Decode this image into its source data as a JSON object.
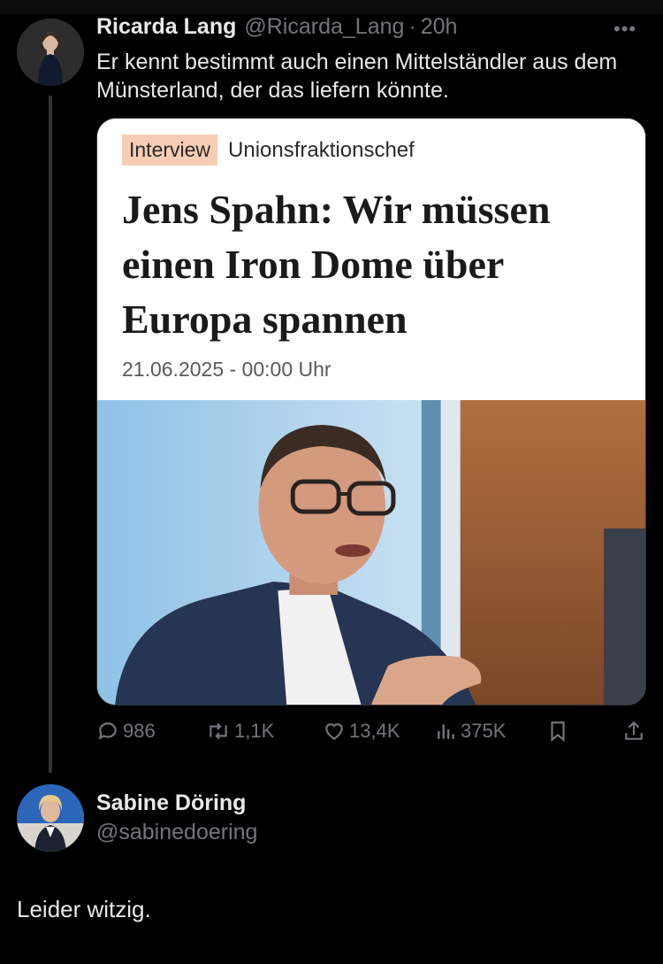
{
  "tweet": {
    "author_name": "Ricarda Lang",
    "author_handle": "@Ricarda_Lang",
    "separator": "·",
    "time": "20h",
    "more": "•••",
    "text": "Er kennt bestimmt auch einen Mittelständler aus dem Münsterland, der das liefern könnte."
  },
  "card": {
    "tag": "Interview",
    "kicker": "Unionsfraktionschef",
    "headline": "Jens Spahn: Wir müssen einen Iron Dome über Europa spannen",
    "date": "21.06.2025 - 00:00 Uhr"
  },
  "actions": {
    "replies": "986",
    "reposts": "1,1K",
    "likes": "13,4K",
    "views": "375K",
    "icons": [
      "reply-icon",
      "repost-icon",
      "like-icon",
      "views-icon",
      "bookmark-icon",
      "share-icon"
    ]
  },
  "reply": {
    "author_name": "Sabine Döring",
    "author_handle": "@sabinedoering",
    "text": "Leider witzig."
  },
  "colors": {
    "background": "#000000",
    "text": "#e7e9ea",
    "muted": "#71767b",
    "tag_bg": "#f7cdb5"
  }
}
